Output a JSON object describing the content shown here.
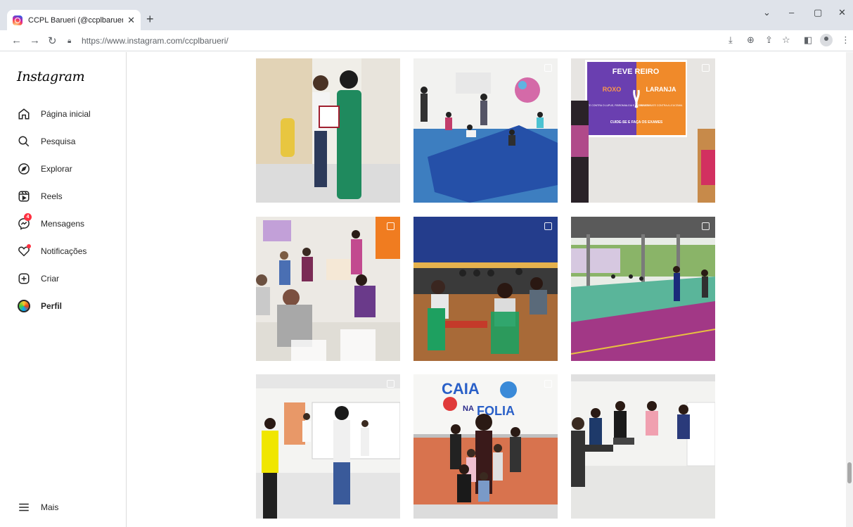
{
  "browser": {
    "tab_title": "CCPL Barueri (@ccplbarueri) • Fo",
    "tab_close": "✕",
    "new_tab": "+",
    "url": "https://www.instagram.com/ccplbarueri/",
    "icons": [
      "install-icon",
      "zoom-icon",
      "share-icon",
      "bookmark-star-icon",
      "side-panel-icon",
      "profile-icon",
      "menu-icon"
    ]
  },
  "sidebar": {
    "logo": "Instagram",
    "items": [
      {
        "label": "Página inicial",
        "icon": "home-icon"
      },
      {
        "label": "Pesquisa",
        "icon": "search-icon"
      },
      {
        "label": "Explorar",
        "icon": "compass-icon"
      },
      {
        "label": "Reels",
        "icon": "reels-icon"
      },
      {
        "label": "Mensagens",
        "icon": "messenger-icon",
        "badge": "4"
      },
      {
        "label": "Notificações",
        "icon": "heart-icon"
      },
      {
        "label": "Criar",
        "icon": "plus-square-icon"
      },
      {
        "label": "Perfil",
        "icon": "avatar"
      }
    ],
    "more": {
      "label": "Mais",
      "icon": "hamburger-icon"
    }
  },
  "posts": [
    {
      "text_lines": [],
      "multi": false
    },
    {
      "text_lines": [],
      "multi": true
    },
    {
      "text_lines": [
        "FEVE REIRO",
        "ROXO",
        "LARANJA",
        "EM COMBATE CONTRA O LUPUS, FIBROMIALGIA E ALZHEIMER",
        "EM COMBATE CONTRA A LEUCEMIA",
        "CUIDE-SE E FAÇA OS EXAMES"
      ],
      "multi": true
    },
    {
      "text_lines": [],
      "multi": true
    },
    {
      "text_lines": [],
      "multi": true
    },
    {
      "text_lines": [],
      "multi": true
    },
    {
      "text_lines": [],
      "multi": true
    },
    {
      "text_lines": [
        "CAIA",
        "NA",
        "FOLIA"
      ],
      "multi": true
    },
    {
      "text_lines": [],
      "multi": false
    }
  ],
  "colors": {
    "accent_badge": "#ff3040",
    "border": "#dbdbdb"
  }
}
